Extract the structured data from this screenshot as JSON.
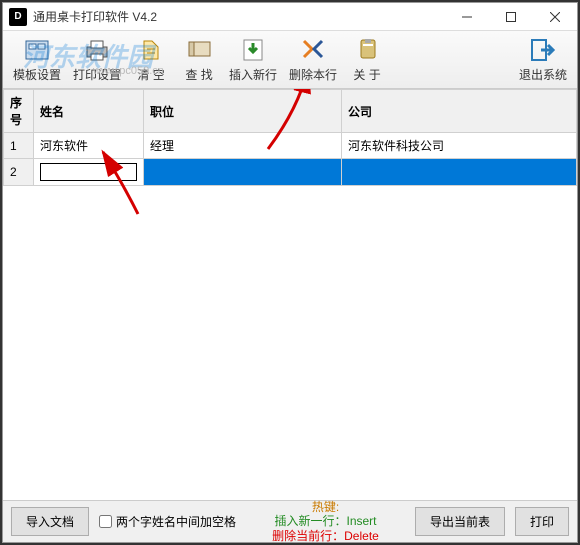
{
  "titlebar": {
    "icon_letter": "D",
    "title": "通用桌卡打印软件   V4.2"
  },
  "watermark": {
    "text": "河东软件园",
    "url": "www.pc059.cn"
  },
  "toolbar": {
    "template": "模板设置",
    "print_settings": "打印设置",
    "clear": "清  空",
    "search": "查  找",
    "insert_row": "插入新行",
    "delete_row": "删除本行",
    "about": "关  于",
    "exit": "退出系统"
  },
  "table": {
    "headers": {
      "seq": "序号",
      "name": "姓名",
      "position": "职位",
      "company": "公司"
    },
    "rows": [
      {
        "seq": "1",
        "name": "河东软件",
        "position": "经理",
        "company": "河东软件科技公司"
      },
      {
        "seq": "2",
        "name": "",
        "position": "",
        "company": ""
      }
    ]
  },
  "footer": {
    "import": "导入文档",
    "checkbox": "两个字姓名中间加空格",
    "hotkey_title": "热键:",
    "hotkey_insert": "插入新一行：Insert",
    "hotkey_delete": "删除当前行：Delete",
    "export": "导出当前表",
    "print": "打印"
  }
}
